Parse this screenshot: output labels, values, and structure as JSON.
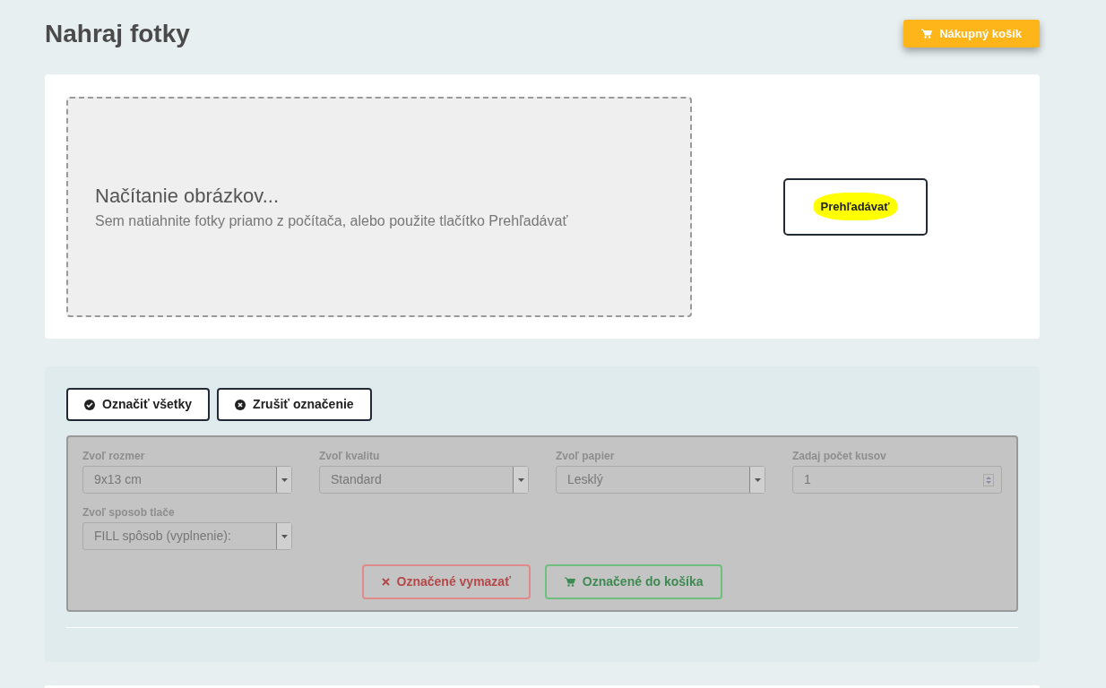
{
  "page": {
    "title": "Nahraj fotky",
    "cart_button": "Nákupný košík"
  },
  "upload": {
    "heading": "Načítanie obrázkov...",
    "hint": "Sem natiahnite fotky priamo z počítača, alebo použite tlačítko Prehľadávať",
    "browse_button": "Prehľadávať"
  },
  "selection": {
    "buttons": [
      {
        "label": "Označiť všetky",
        "kind": "check"
      },
      {
        "label": "Zrušiť označenie",
        "kind": "cancel"
      }
    ],
    "options_panel": {
      "disabled": true,
      "fields": [
        {
          "label": "Zvoľ rozmer",
          "value": "9x13 cm",
          "kind": "select"
        },
        {
          "label": "Zvoľ kvalitu",
          "value": "Standard",
          "kind": "select"
        },
        {
          "label": "Zvoľ papier",
          "value": "Lesklý",
          "kind": "select"
        },
        {
          "label": "Zadaj počet kusov",
          "value": "1",
          "kind": "number"
        },
        {
          "label": "Zvoľ sposob tlače",
          "value": "FILL spôsob (vyplnenie):",
          "kind": "select"
        }
      ],
      "actions": [
        {
          "label": "Označené vymazať",
          "kind": "delete"
        },
        {
          "label": "Označené do košíka",
          "kind": "cart"
        }
      ]
    }
  }
}
